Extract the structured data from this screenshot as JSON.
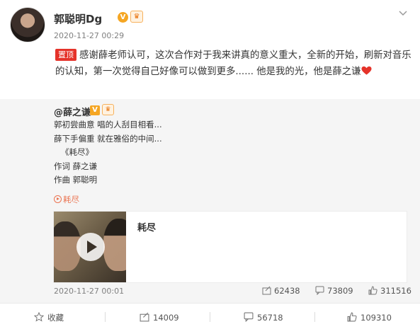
{
  "post": {
    "author": "郭聪明Dg",
    "verified_icon": "verified-badge-icon",
    "vip_icon": "vip-member-icon",
    "time": "2020-11-27 00:29",
    "pin_label": "置顶",
    "text": "感谢薛老师认可，这次合作对于我来讲真的意义重大，全新的开始，刷新对音乐的认知，第一次觉得自己好像可以做到更多...... 他是我的光，他是薛之谦"
  },
  "repost": {
    "author": "@薛之谦",
    "lines": [
      "郭初尝曲意 唱的人刮目相看...",
      "薛下手偏重 就在雅俗的中间...",
      "《耗尽》",
      "作词 薛之谦",
      "作曲 郭聪明"
    ],
    "music_link": "耗尽",
    "card_title": "耗尽",
    "time": "2020-11-27 00:01",
    "reposts": "62438",
    "comments": "73809",
    "likes": "311516"
  },
  "actions": {
    "favorite": "收藏",
    "repost": "14009",
    "comment": "56718",
    "like": "109310"
  },
  "colors": {
    "accent": "#eb7350",
    "pin": "#e5332a",
    "heart": "#e5332a"
  }
}
